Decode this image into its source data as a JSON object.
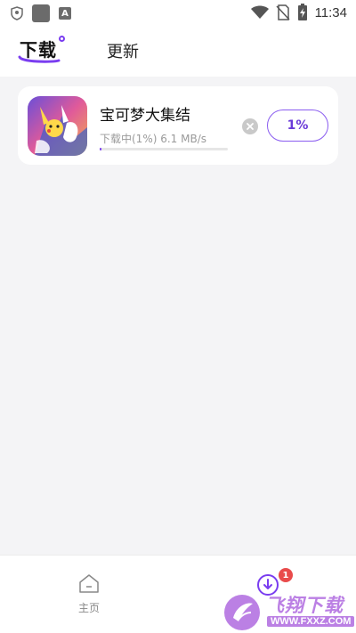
{
  "status_bar": {
    "time": "11:34",
    "icons": [
      "shield-icon",
      "app-square-icon",
      "a-icon",
      "wifi-icon",
      "no-sim-icon",
      "battery-charging-icon"
    ]
  },
  "header": {
    "tabs": [
      {
        "label": "下载",
        "active": true
      },
      {
        "label": "更新",
        "active": false
      }
    ],
    "accent_color": "#7a3df0"
  },
  "downloads": [
    {
      "name": "宝可梦大集结",
      "progress_text": "下载中(1%) 6.1 MB/s",
      "progress": 0.01,
      "button_label": "1%"
    }
  ],
  "bottom_nav": {
    "home_label": "主页",
    "download_badge": "1"
  },
  "watermark": {
    "text": "飞翔下载",
    "url": "WWW.FXXZ.COM"
  }
}
